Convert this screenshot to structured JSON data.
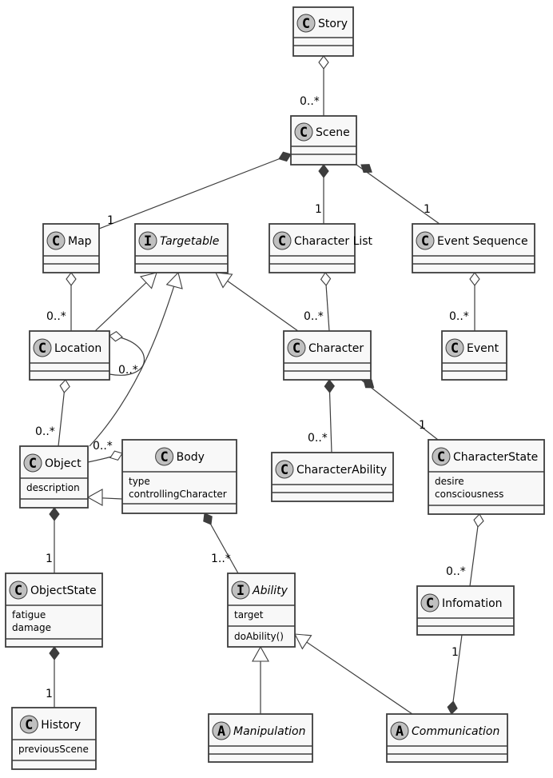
{
  "diagram": {
    "type": "UML class diagram",
    "classes": [
      {
        "id": "story",
        "name": "Story",
        "kind": "class",
        "stereotype": "C",
        "attributes": [],
        "methods": []
      },
      {
        "id": "scene",
        "name": "Scene",
        "kind": "class",
        "stereotype": "C",
        "attributes": [],
        "methods": []
      },
      {
        "id": "map",
        "name": "Map",
        "kind": "class",
        "stereotype": "C",
        "attributes": [],
        "methods": []
      },
      {
        "id": "targetable",
        "name": "Targetable",
        "kind": "interface",
        "stereotype": "I",
        "attributes": [],
        "methods": []
      },
      {
        "id": "character-list",
        "name": "Character List",
        "kind": "class",
        "stereotype": "C",
        "attributes": [],
        "methods": []
      },
      {
        "id": "event-sequence",
        "name": "Event Sequence",
        "kind": "class",
        "stereotype": "C",
        "attributes": [],
        "methods": []
      },
      {
        "id": "location",
        "name": "Location",
        "kind": "class",
        "stereotype": "C",
        "attributes": [],
        "methods": []
      },
      {
        "id": "character",
        "name": "Character",
        "kind": "class",
        "stereotype": "C",
        "attributes": [],
        "methods": []
      },
      {
        "id": "event",
        "name": "Event",
        "kind": "class",
        "stereotype": "C",
        "attributes": [],
        "methods": []
      },
      {
        "id": "object",
        "name": "Object",
        "kind": "class",
        "stereotype": "C",
        "attributes": [
          "description"
        ],
        "methods": []
      },
      {
        "id": "body",
        "name": "Body",
        "kind": "class",
        "stereotype": "C",
        "attributes": [
          "type",
          "controllingCharacter"
        ],
        "methods": []
      },
      {
        "id": "character-ability",
        "name": "CharacterAbility",
        "kind": "class",
        "stereotype": "C",
        "attributes": [],
        "methods": []
      },
      {
        "id": "character-state",
        "name": "CharacterState",
        "kind": "class",
        "stereotype": "C",
        "attributes": [
          "desire",
          "consciousness"
        ],
        "methods": []
      },
      {
        "id": "object-state",
        "name": "ObjectState",
        "kind": "class",
        "stereotype": "C",
        "attributes": [
          "fatigue",
          "damage"
        ],
        "methods": []
      },
      {
        "id": "ability",
        "name": "Ability",
        "kind": "interface",
        "stereotype": "I",
        "attributes": [
          "target"
        ],
        "methods": [
          "doAbility()"
        ]
      },
      {
        "id": "information",
        "name": "Infomation",
        "kind": "class",
        "stereotype": "C",
        "attributes": [],
        "methods": []
      },
      {
        "id": "history",
        "name": "History",
        "kind": "class",
        "stereotype": "C",
        "attributes": [
          "previousScene"
        ],
        "methods": []
      },
      {
        "id": "manipulation",
        "name": "Manipulation",
        "kind": "abstract",
        "stereotype": "A",
        "attributes": [],
        "methods": []
      },
      {
        "id": "communication",
        "name": "Communication",
        "kind": "abstract",
        "stereotype": "A",
        "attributes": [],
        "methods": []
      }
    ],
    "relations": [
      {
        "from": "story",
        "to": "scene",
        "type": "aggregation",
        "multiplicity": "0..*"
      },
      {
        "from": "scene",
        "to": "map",
        "type": "composition",
        "multiplicity": "1"
      },
      {
        "from": "scene",
        "to": "character-list",
        "type": "composition",
        "multiplicity": "1"
      },
      {
        "from": "scene",
        "to": "event-sequence",
        "type": "composition",
        "multiplicity": "1"
      },
      {
        "from": "map",
        "to": "location",
        "type": "aggregation",
        "multiplicity": "0..*"
      },
      {
        "from": "location",
        "to": "targetable",
        "type": "realization",
        "multiplicity": ""
      },
      {
        "from": "object",
        "to": "targetable",
        "type": "realization",
        "multiplicity": ""
      },
      {
        "from": "character",
        "to": "targetable",
        "type": "realization",
        "multiplicity": ""
      },
      {
        "from": "character-list",
        "to": "character",
        "type": "aggregation",
        "multiplicity": "0..*"
      },
      {
        "from": "event-sequence",
        "to": "event",
        "type": "aggregation",
        "multiplicity": "0..*"
      },
      {
        "from": "location",
        "to": "location",
        "type": "aggregation",
        "multiplicity": "0..*"
      },
      {
        "from": "location",
        "to": "object",
        "type": "aggregation",
        "multiplicity": "0..*"
      },
      {
        "from": "body",
        "to": "object",
        "type": "aggregation",
        "multiplicity": "0..*"
      },
      {
        "from": "body",
        "to": "object",
        "type": "inheritance",
        "multiplicity": ""
      },
      {
        "from": "character",
        "to": "character-ability",
        "type": "composition",
        "multiplicity": "0..*"
      },
      {
        "from": "character",
        "to": "character-state",
        "type": "composition",
        "multiplicity": "1"
      },
      {
        "from": "object",
        "to": "object-state",
        "type": "composition",
        "multiplicity": "1"
      },
      {
        "from": "body",
        "to": "ability",
        "type": "composition",
        "multiplicity": "1..*"
      },
      {
        "from": "character-state",
        "to": "information",
        "type": "aggregation",
        "multiplicity": "0..*"
      },
      {
        "from": "object-state",
        "to": "history",
        "type": "composition",
        "multiplicity": "1"
      },
      {
        "from": "manipulation",
        "to": "ability",
        "type": "inheritance",
        "multiplicity": ""
      },
      {
        "from": "communication",
        "to": "ability",
        "type": "inheritance",
        "multiplicity": ""
      },
      {
        "from": "communication",
        "to": "information",
        "type": "composition",
        "multiplicity": "1"
      }
    ]
  }
}
